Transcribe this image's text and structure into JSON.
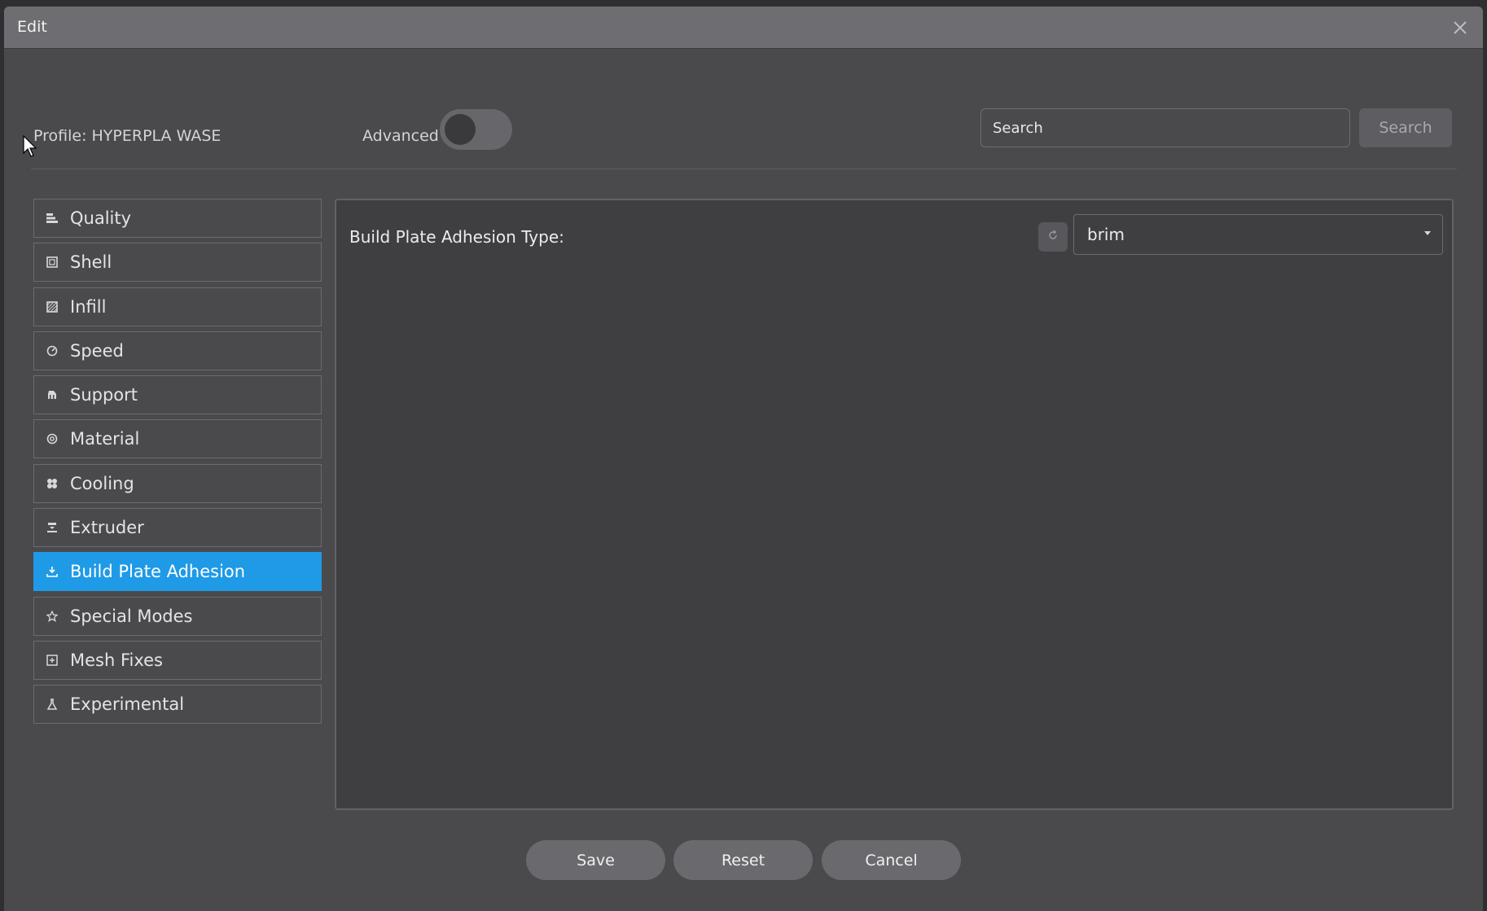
{
  "window": {
    "title": "Edit"
  },
  "header": {
    "profile_label": "Profile:  HYPERPLA WASE",
    "advanced_label": "Advanced",
    "advanced_enabled": false,
    "search_placeholder": "Search",
    "search_button": "Search"
  },
  "sidebar": {
    "items": [
      {
        "label": "Quality",
        "icon": "quality-icon",
        "active": false
      },
      {
        "label": "Shell",
        "icon": "shell-icon",
        "active": false
      },
      {
        "label": "Infill",
        "icon": "infill-icon",
        "active": false
      },
      {
        "label": "Speed",
        "icon": "speed-icon",
        "active": false
      },
      {
        "label": "Support",
        "icon": "support-icon",
        "active": false
      },
      {
        "label": "Material",
        "icon": "material-icon",
        "active": false
      },
      {
        "label": "Cooling",
        "icon": "cooling-icon",
        "active": false
      },
      {
        "label": "Extruder",
        "icon": "extruder-icon",
        "active": false
      },
      {
        "label": "Build Plate Adhesion",
        "icon": "build-plate-adhesion-icon",
        "active": true
      },
      {
        "label": "Special Modes",
        "icon": "star-icon",
        "active": false
      },
      {
        "label": "Mesh Fixes",
        "icon": "mesh-fixes-icon",
        "active": false
      },
      {
        "label": "Experimental",
        "icon": "flask-icon",
        "active": false
      }
    ]
  },
  "content": {
    "setting_label": "Build Plate Adhesion Type:",
    "setting_value": "brim"
  },
  "footer": {
    "save_label": "Save",
    "reset_label": "Reset",
    "cancel_label": "Cancel"
  },
  "colors": {
    "accent": "#1f9ae6",
    "window_bg": "#4a4a4d",
    "titlebar_bg": "#6e6e72",
    "panel_bg": "#3f3f42"
  }
}
